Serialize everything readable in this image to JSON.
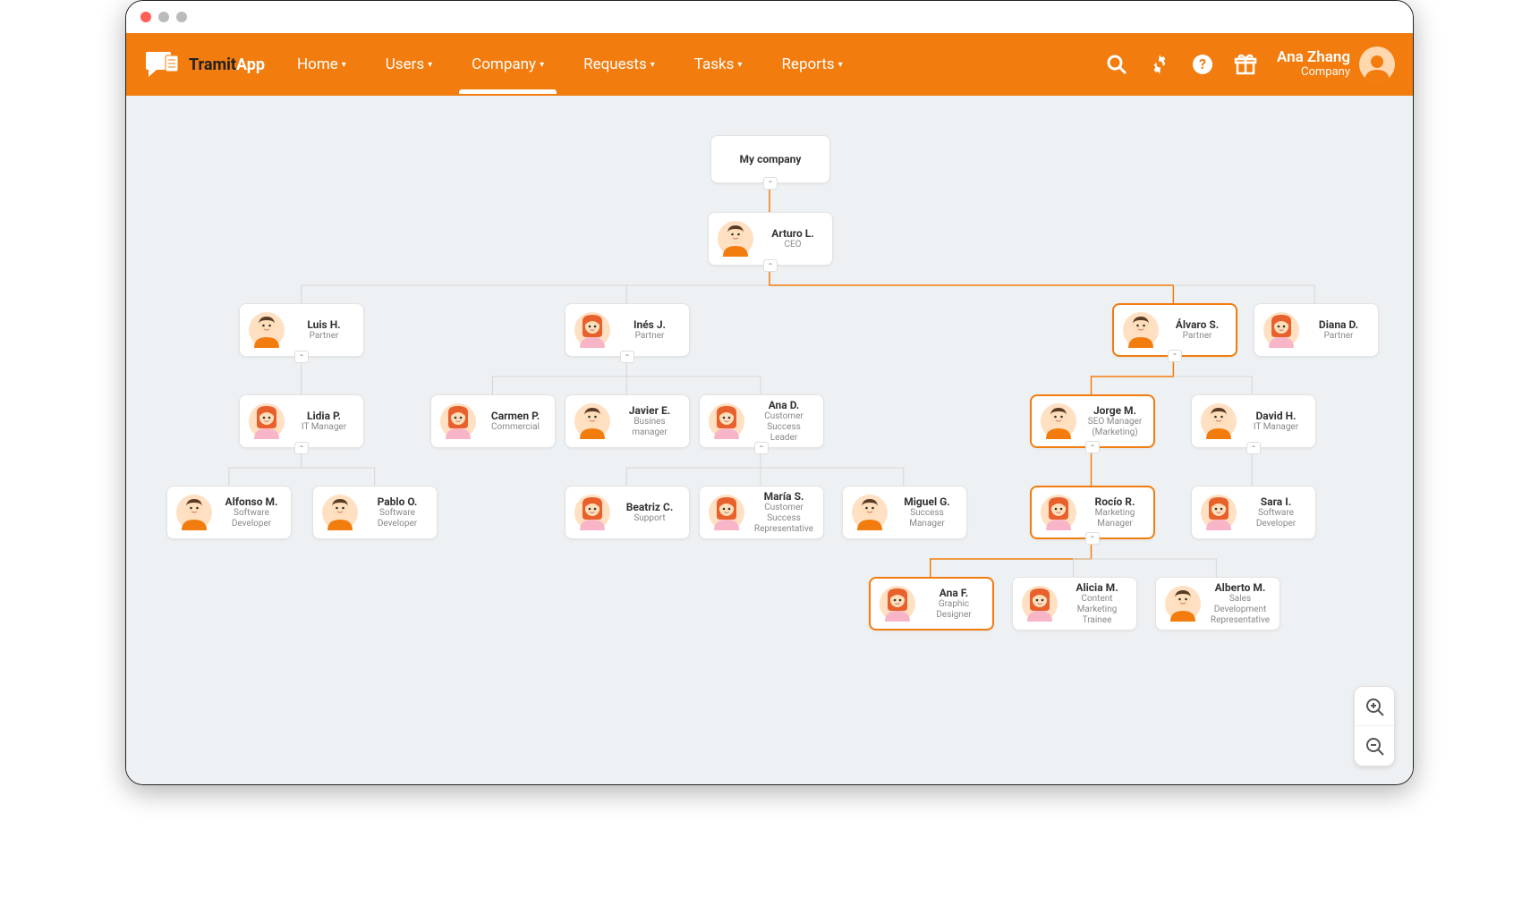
{
  "app": {
    "logo_text_a": "Tramit",
    "logo_text_b": "App"
  },
  "nav": {
    "items": [
      {
        "label": "Home"
      },
      {
        "label": "Users"
      },
      {
        "label": "Company",
        "active": true
      },
      {
        "label": "Requests"
      },
      {
        "label": "Tasks"
      },
      {
        "label": "Reports"
      }
    ]
  },
  "user": {
    "name": "Ana Zhang",
    "role": "Company"
  },
  "org": {
    "root": {
      "label": "My company"
    },
    "nodes": {
      "ceo": {
        "name": "Arturo L.",
        "role": "CEO",
        "avatar": "m1"
      },
      "luis": {
        "name": "Luis H.",
        "role": "Partner",
        "avatar": "m1"
      },
      "ines": {
        "name": "Inés J.",
        "role": "Partner",
        "avatar": "f1"
      },
      "alvaro": {
        "name": "Álvaro S.",
        "role": "Partner",
        "avatar": "m1",
        "highlight": true
      },
      "diana": {
        "name": "Diana D.",
        "role": "Partner",
        "avatar": "f1"
      },
      "lidia": {
        "name": "Lidia P.",
        "role": "IT Manager",
        "avatar": "f1"
      },
      "carmen": {
        "name": "Carmen P.",
        "role": "Commercial",
        "avatar": "f1"
      },
      "javier": {
        "name": "Javier E.",
        "role": "Busines manager",
        "avatar": "m1"
      },
      "anad": {
        "name": "Ana D.",
        "role": "Customer Success Leader",
        "avatar": "f1"
      },
      "jorge": {
        "name": "Jorge M.",
        "role": "SEO Manager (Marketing)",
        "avatar": "m1",
        "highlight": true
      },
      "david": {
        "name": "David H.",
        "role": "IT Manager",
        "avatar": "m1"
      },
      "alfonso": {
        "name": "Alfonso M.",
        "role": "Software Developer",
        "avatar": "m1"
      },
      "pablo": {
        "name": "Pablo O.",
        "role": "Software Developer",
        "avatar": "m1"
      },
      "beatriz": {
        "name": "Beatriz C.",
        "role": "Support",
        "avatar": "f1"
      },
      "maria": {
        "name": "María S.",
        "role": "Customer Success Representative",
        "avatar": "f1"
      },
      "miguel": {
        "name": "Miguel G.",
        "role": "Success Manager",
        "avatar": "m1"
      },
      "rocio": {
        "name": "Rocío R.",
        "role": "Marketing Manager",
        "avatar": "f1",
        "highlight": true
      },
      "sara": {
        "name": "Sara I.",
        "role": "Software Developer",
        "avatar": "f1"
      },
      "anaf": {
        "name": "Ana F.",
        "role": "Graphic Designer",
        "avatar": "f1",
        "highlight": true
      },
      "alicia": {
        "name": "Alicia M.",
        "role": "Content Marketing Trainee",
        "avatar": "f1"
      },
      "alberto": {
        "name": "Alberto M.",
        "role": "Sales Development Representative",
        "avatar": "m1"
      }
    }
  }
}
